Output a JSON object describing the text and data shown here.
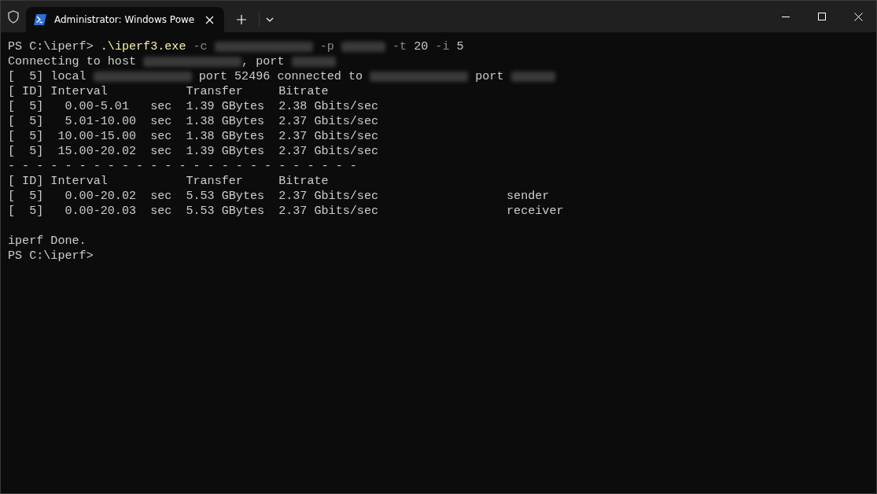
{
  "tab": {
    "title": "Administrator: Windows Powe",
    "selected": true
  },
  "terminal": {
    "lines": [
      {
        "segments": [
          {
            "kind": "text",
            "text": "PS C:\\iperf> "
          },
          {
            "kind": "command",
            "text": ".\\iperf3.exe"
          },
          {
            "kind": "param",
            "text": " -c "
          },
          {
            "kind": "redacted_ip"
          },
          {
            "kind": "param",
            "text": " -p "
          },
          {
            "kind": "redacted_port"
          },
          {
            "kind": "param",
            "text": " -t "
          },
          {
            "kind": "text",
            "text": "20"
          },
          {
            "kind": "param",
            "text": " -i "
          },
          {
            "kind": "text",
            "text": "5"
          }
        ]
      },
      {
        "segments": [
          {
            "kind": "text",
            "text": "Connecting to host "
          },
          {
            "kind": "redacted_ip"
          },
          {
            "kind": "text",
            "text": ", port "
          },
          {
            "kind": "redacted_port"
          }
        ]
      },
      {
        "segments": [
          {
            "kind": "text",
            "text": "[  5] local "
          },
          {
            "kind": "redacted_ip"
          },
          {
            "kind": "text",
            "text": " port 52496 connected to "
          },
          {
            "kind": "redacted_ip"
          },
          {
            "kind": "text",
            "text": " port "
          },
          {
            "kind": "redacted_port"
          }
        ]
      },
      {
        "segments": [
          {
            "kind": "text",
            "text": "[ ID] Interval           Transfer     Bitrate"
          }
        ]
      },
      {
        "segments": [
          {
            "kind": "text",
            "text": "[  5]   0.00-5.01   sec  1.39 GBytes  2.38 Gbits/sec"
          }
        ]
      },
      {
        "segments": [
          {
            "kind": "text",
            "text": "[  5]   5.01-10.00  sec  1.38 GBytes  2.37 Gbits/sec"
          }
        ]
      },
      {
        "segments": [
          {
            "kind": "text",
            "text": "[  5]  10.00-15.00  sec  1.38 GBytes  2.37 Gbits/sec"
          }
        ]
      },
      {
        "segments": [
          {
            "kind": "text",
            "text": "[  5]  15.00-20.02  sec  1.39 GBytes  2.37 Gbits/sec"
          }
        ]
      },
      {
        "segments": [
          {
            "kind": "text",
            "text": "- - - - - - - - - - - - - - - - - - - - - - - - -"
          }
        ]
      },
      {
        "segments": [
          {
            "kind": "text",
            "text": "[ ID] Interval           Transfer     Bitrate"
          }
        ]
      },
      {
        "segments": [
          {
            "kind": "text",
            "text": "[  5]   0.00-20.02  sec  5.53 GBytes  2.37 Gbits/sec                  sender"
          }
        ]
      },
      {
        "segments": [
          {
            "kind": "text",
            "text": "[  5]   0.00-20.03  sec  5.53 GBytes  2.37 Gbits/sec                  receiver"
          }
        ]
      },
      {
        "segments": [
          {
            "kind": "blank"
          }
        ]
      },
      {
        "segments": [
          {
            "kind": "text",
            "text": "iperf Done."
          }
        ]
      },
      {
        "segments": [
          {
            "kind": "text",
            "text": "PS C:\\iperf>"
          }
        ]
      }
    ]
  }
}
